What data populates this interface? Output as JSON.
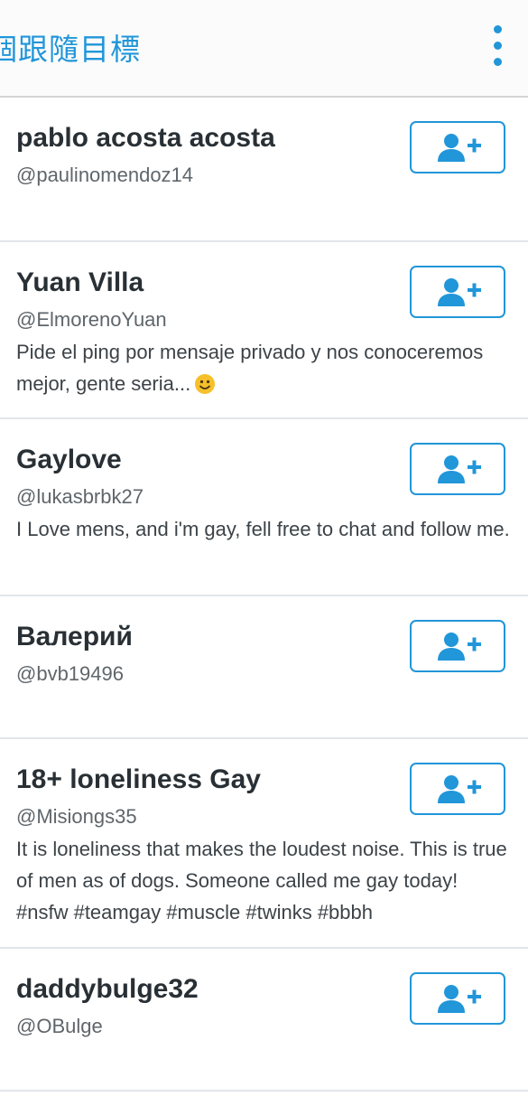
{
  "header": {
    "title": "個跟隨目標",
    "menu_icon": "more-vert-icon"
  },
  "colors": {
    "accent": "#2196d9",
    "name_text": "#293035",
    "secondary_text": "#5f666b",
    "divider": "#e1e6ea"
  },
  "follow_button_icon": "add-user-icon",
  "users": [
    {
      "name": "pablo acosta acosta",
      "handle": "@paulinomendoz14",
      "bio": ""
    },
    {
      "name": "Yuan Villa",
      "handle": "@ElmorenoYuan",
      "bio": "Pide el ping por mensaje privado y nos conoceremos mejor, gente seria...",
      "bio_emoji": "smiling-face-emoji"
    },
    {
      "name": "Gaylove",
      "handle": "@lukasbrbk27",
      "bio": "I  Love mens, and i'm gay, fell free to chat and follow me."
    },
    {
      "name": "Валерий",
      "handle": "@bvb19496",
      "bio": ""
    },
    {
      "name": "18+ loneliness Gay",
      "handle": "@Misiongs35",
      "bio": "It is loneliness that makes the loudest noise. This is true of men as of dogs. Someone called me gay today! #nsfw #teamgay #muscle #twinks #bbbh"
    },
    {
      "name": "daddybulge32",
      "handle": "@OBulge",
      "bio": ""
    }
  ]
}
